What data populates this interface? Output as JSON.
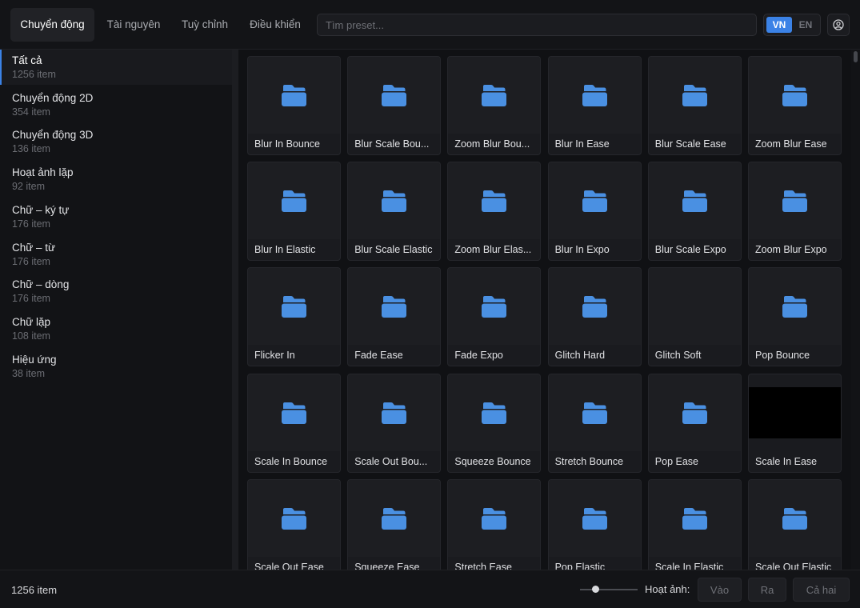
{
  "tabs": [
    {
      "label": "Chuyển động",
      "active": true
    },
    {
      "label": "Tài nguyên",
      "active": false
    },
    {
      "label": "Tuỳ chỉnh",
      "active": false
    },
    {
      "label": "Điều khiển",
      "active": false
    }
  ],
  "search": {
    "placeholder": "Tìm preset..."
  },
  "lang": {
    "active": "VN",
    "inactive": "EN"
  },
  "sidebar": {
    "items": [
      {
        "name": "Tất cả",
        "count": "1256 item",
        "active": true
      },
      {
        "name": "Chuyển động 2D",
        "count": "354 item"
      },
      {
        "name": "Chuyển động 3D",
        "count": "136 item"
      },
      {
        "name": "Hoạt ảnh lặp",
        "count": "92 item"
      },
      {
        "name": "Chữ – ký tự",
        "count": "176 item"
      },
      {
        "name": "Chữ – từ",
        "count": "176 item"
      },
      {
        "name": "Chữ – dòng",
        "count": "176 item"
      },
      {
        "name": "Chữ lặp",
        "count": "108 item"
      },
      {
        "name": "Hiệu ứng",
        "count": "38 item"
      }
    ]
  },
  "presets": [
    {
      "label": "Blur In Bounce",
      "thumb": "folder"
    },
    {
      "label": "Blur Scale Bou...",
      "thumb": "folder"
    },
    {
      "label": "Zoom Blur Bou...",
      "thumb": "folder"
    },
    {
      "label": "Blur In Ease",
      "thumb": "folder"
    },
    {
      "label": "Blur Scale Ease",
      "thumb": "folder"
    },
    {
      "label": "Zoom Blur Ease",
      "thumb": "folder"
    },
    {
      "label": "Blur In Elastic",
      "thumb": "folder"
    },
    {
      "label": "Blur Scale Elastic",
      "thumb": "folder"
    },
    {
      "label": "Zoom Blur Elas...",
      "thumb": "folder"
    },
    {
      "label": "Blur In Expo",
      "thumb": "folder"
    },
    {
      "label": "Blur Scale Expo",
      "thumb": "folder"
    },
    {
      "label": "Zoom Blur Expo",
      "thumb": "folder"
    },
    {
      "label": "Flicker In",
      "thumb": "folder"
    },
    {
      "label": "Fade Ease",
      "thumb": "folder"
    },
    {
      "label": "Fade Expo",
      "thumb": "folder"
    },
    {
      "label": "Glitch Hard",
      "thumb": "folder"
    },
    {
      "label": "Glitch Soft",
      "thumb": "none"
    },
    {
      "label": "Pop Bounce",
      "thumb": "folder"
    },
    {
      "label": "Scale In Bounce",
      "thumb": "folder"
    },
    {
      "label": "Scale Out Bou...",
      "thumb": "folder"
    },
    {
      "label": "Squeeze Bounce",
      "thumb": "folder"
    },
    {
      "label": "Stretch Bounce",
      "thumb": "folder"
    },
    {
      "label": "Pop Ease",
      "thumb": "folder"
    },
    {
      "label": "Scale In Ease",
      "thumb": "black"
    },
    {
      "label": "Scale Out Ease",
      "thumb": "folder"
    },
    {
      "label": "Squeeze Ease",
      "thumb": "folder"
    },
    {
      "label": "Stretch Ease",
      "thumb": "folder"
    },
    {
      "label": "Pop Elastic",
      "thumb": "folder"
    },
    {
      "label": "Scale In Elastic",
      "thumb": "folder"
    },
    {
      "label": "Scale Out Elastic",
      "thumb": "folder"
    }
  ],
  "footer": {
    "count": "1256 item",
    "thumb_size_level": 0.27,
    "anim_label": "Hoạt ảnh:",
    "buttons": [
      "Vào",
      "Ra",
      "Cả hai"
    ]
  },
  "colors": {
    "accent": "#3b82e6",
    "folder": "#4a90e2"
  }
}
